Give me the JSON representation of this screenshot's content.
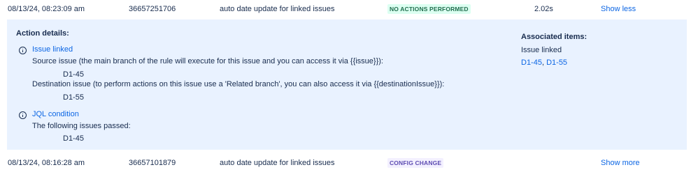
{
  "rows": [
    {
      "date": "08/13/24, 08:23:09 am",
      "id": "36657251706",
      "rule": "auto date update for linked issues",
      "status": "NO ACTIONS PERFORMED",
      "duration": "2.02s",
      "toggle": "Show less"
    },
    {
      "date": "08/13/24, 08:16:28 am",
      "id": "36657101879",
      "rule": "auto date update for linked issues",
      "status": "CONFIG CHANGE",
      "duration": "",
      "toggle": "Show more"
    }
  ],
  "details": {
    "heading": "Action details:",
    "sections": [
      {
        "icon": "info-icon",
        "title": "Issue linked",
        "lines": [
          "Source issue (the main branch of the rule will execute for this issue and you can access it via {{issue}}):",
          "D1-45",
          "Destination issue (to perform actions on this issue use a 'Related branch', you can also access it via {{destinationIssue}}):",
          "D1-55"
        ]
      },
      {
        "icon": "info-icon",
        "title": "JQL condition",
        "lines": [
          "The following issues passed:",
          "D1-45"
        ]
      }
    ],
    "associated": {
      "heading": "Associated items:",
      "label": "Issue linked",
      "links": [
        "D1-45",
        "D1-55"
      ]
    }
  },
  "colors": {
    "link": "#0c66e4",
    "details_bg": "#e9f2ff",
    "badge_green_bg": "#dcfff1",
    "badge_green_text": "#216e4e",
    "badge_purple_bg": "#f3f0ff",
    "badge_purple_text": "#5e4db2"
  }
}
